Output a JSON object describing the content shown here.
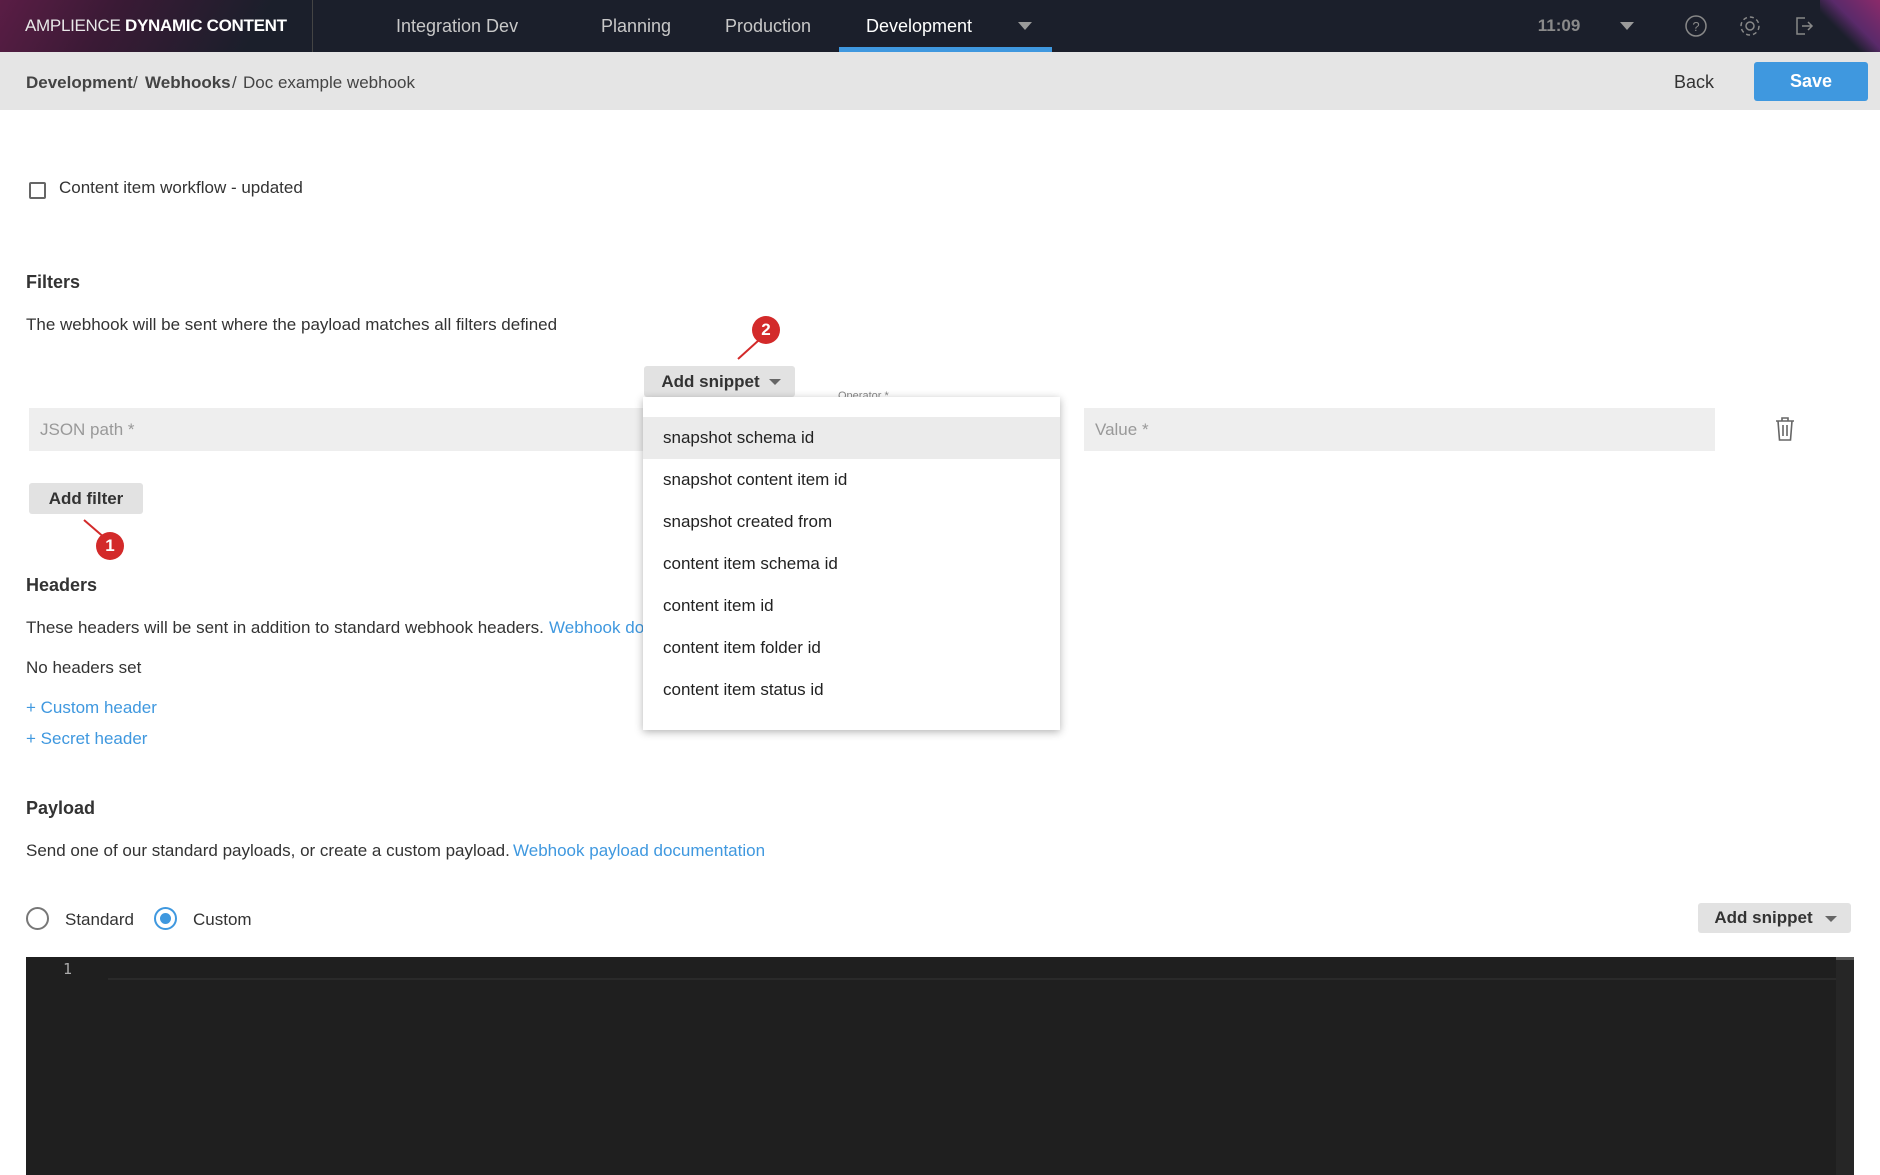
{
  "app": {
    "brand_light": "AMPLIENCE",
    "brand_bold": "DYNAMIC CONTENT",
    "hub": "Integration Dev",
    "time": "11:09"
  },
  "nav": {
    "items": [
      {
        "label": "Planning"
      },
      {
        "label": "Production"
      },
      {
        "label": "Development",
        "active": true
      }
    ]
  },
  "icons": {
    "help": "help-circle-icon",
    "settings": "gear-icon",
    "logout": "logout-icon",
    "delete": "trash-icon"
  },
  "breadcrumb": {
    "items": [
      "Development",
      "Webhooks"
    ],
    "current": "Doc example webhook",
    "separator": "/"
  },
  "toolbar": {
    "back_label": "Back",
    "save_label": "Save"
  },
  "trigger": {
    "label": "Content item workflow - updated",
    "checked": false
  },
  "filters": {
    "title": "Filters",
    "description": "The webhook will be sent where the payload matches all filters defined",
    "json_path_placeholder": "JSON path *",
    "operator_label": "Operator *",
    "value_placeholder": "Value *",
    "add_snippet_label": "Add snippet",
    "add_filter_label": "Add filter",
    "snippet_options": [
      "snapshot schema id",
      "snapshot content item id",
      "snapshot created from",
      "content item schema id",
      "content item id",
      "content item folder id",
      "content item status id"
    ]
  },
  "annotations": [
    "1",
    "2"
  ],
  "headers": {
    "title": "Headers",
    "description": "These headers will be sent in addition to standard webhook headers.",
    "doc_link": "Webhook do",
    "empty": "No headers set",
    "custom_link": "+ Custom header",
    "secret_link": "+ Secret header"
  },
  "payload": {
    "title": "Payload",
    "description": "Send one of our standard payloads, or create a custom payload.",
    "doc_link": "Webhook payload documentation",
    "options": [
      "Standard",
      "Custom"
    ],
    "selected": "Custom",
    "add_snippet_label": "Add snippet",
    "line_number": "1"
  },
  "colors": {
    "accent": "#3f98df",
    "topbar": "#1b1f2b",
    "badge": "#d32a2a",
    "editor": "#1f1f1f"
  }
}
